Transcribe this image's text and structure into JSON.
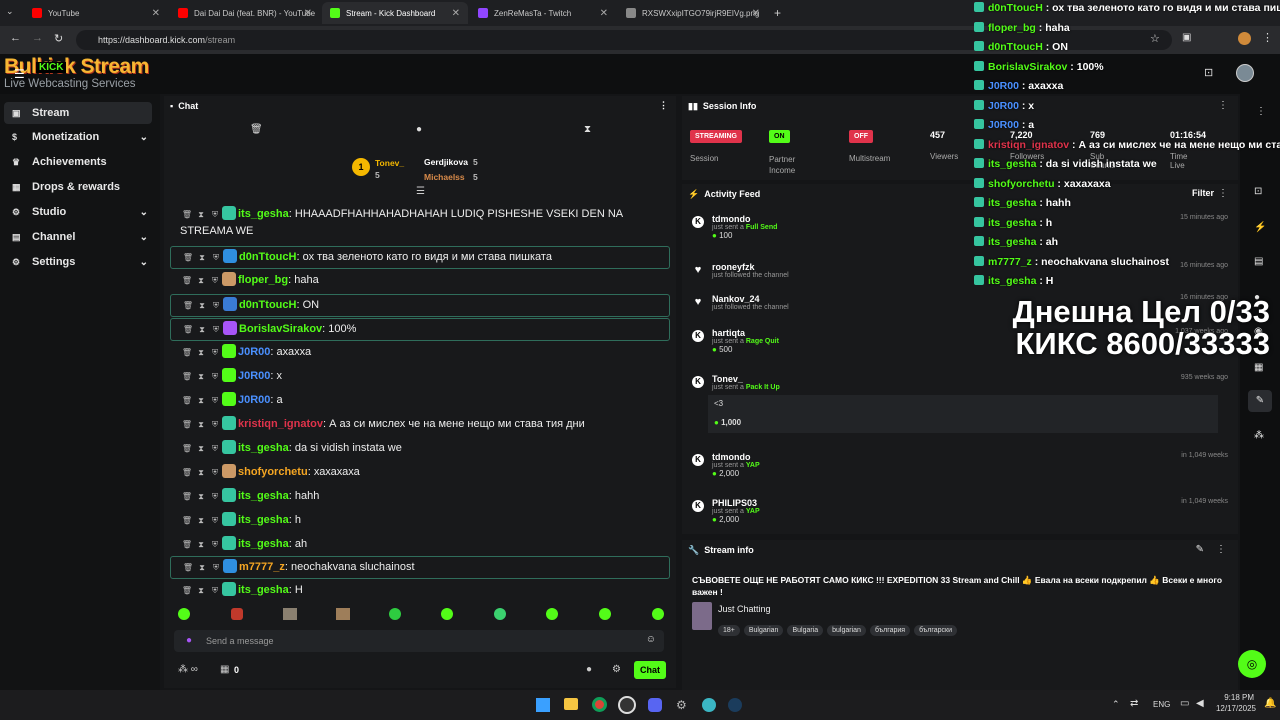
{
  "browser": {
    "tabs": [
      {
        "label": "YouTube",
        "color": "#ff0000"
      },
      {
        "label": "Dai Dai Dai (feat. BNR) - YouTube",
        "color": "#ff0000"
      },
      {
        "label": "Stream - Kick Dashboard",
        "color": "#53fc18"
      },
      {
        "label": "ZenReMasTa - Twitch",
        "color": "#9146ff"
      },
      {
        "label": "RXSWXxipITGO79irjR9EIVg.png",
        "color": "#888888"
      }
    ],
    "url_host": "https://dashboard.kick.com",
    "url_path": "/stream"
  },
  "brand": {
    "logo_text": "Bulkick Stream",
    "logo_sub": "Live Webcasting Services",
    "kick_tag": "KICK"
  },
  "sidebar": {
    "items": [
      {
        "label": "Stream",
        "icon": "monitor-icon",
        "active": true
      },
      {
        "label": "Monetization",
        "icon": "dollar-icon",
        "chevron": true
      },
      {
        "label": "Achievements",
        "icon": "trophy-icon"
      },
      {
        "label": "Drops & rewards",
        "icon": "gift-icon"
      },
      {
        "label": "Studio",
        "icon": "studio-icon",
        "chevron": true
      },
      {
        "label": "Channel",
        "icon": "channel-icon",
        "chevron": true
      },
      {
        "label": "Settings",
        "icon": "gear-icon",
        "chevron": true
      }
    ]
  },
  "chat": {
    "title": "Chat",
    "leaderboard": {
      "first": {
        "name": "Tonev_",
        "count": "5"
      },
      "second": {
        "name": "Gerdjikova",
        "count": "5"
      },
      "third": {
        "name": "Michaelss",
        "count": "5"
      }
    },
    "messages": [
      {
        "user": "its_gesha",
        "text": "HHAAADFHAHHAHADHAHAH LUDIQ PISHESHE VSEKI DEN NA STREAMA WE",
        "color": "#53fc18",
        "hl": false
      },
      {
        "user": "d0nTtoucH",
        "text": "ох тва зеленото като го видя и ми става пишката",
        "color": "#53fc18",
        "hl": true
      },
      {
        "user": "floper_bg",
        "text": "haha",
        "color": "#53fc18",
        "hl": false
      },
      {
        "user": "d0nTtoucH",
        "text": "ON",
        "color": "#53fc18",
        "hl": true
      },
      {
        "user": "BorislavSirakov",
        "text": "100%",
        "color": "#53fc18",
        "hl": true
      },
      {
        "user": "J0R00",
        "text": "ахахха",
        "color": "#4a90ff",
        "hl": false
      },
      {
        "user": "J0R00",
        "text": "x",
        "color": "#4a90ff",
        "hl": false
      },
      {
        "user": "J0R00",
        "text": "a",
        "color": "#4a90ff",
        "hl": false
      },
      {
        "user": "kristiqn_ignatov",
        "text": "А аз си мислех че на мене нещо ми става тия дни",
        "color": "#e0334b",
        "hl": false
      },
      {
        "user": "its_gesha",
        "text": "da si vidish instata we",
        "color": "#53fc18",
        "hl": false
      },
      {
        "user": "shofyorchetu",
        "text": "хахахаха",
        "color": "#f5a623",
        "hl": false
      },
      {
        "user": "its_gesha",
        "text": "hahh",
        "color": "#53fc18",
        "hl": false
      },
      {
        "user": "its_gesha",
        "text": "h",
        "color": "#53fc18",
        "hl": false
      },
      {
        "user": "its_gesha",
        "text": "ah",
        "color": "#53fc18",
        "hl": false
      },
      {
        "user": "m7777_z",
        "text": "neochakvana sluchainost",
        "color": "#f5a623",
        "hl": true
      },
      {
        "user": "its_gesha",
        "text": "H",
        "color": "#53fc18",
        "hl": false
      }
    ],
    "input_placeholder": "Send a message",
    "points_count": "0",
    "chat_button": "Chat"
  },
  "session": {
    "title": "Session Info",
    "stats": [
      {
        "badge": "STREAMING",
        "label": "Session",
        "badge_color": "#e0334b"
      },
      {
        "badge": "ON",
        "label": "Partner Income",
        "badge_color": "#53fc18"
      },
      {
        "badge": "OFF",
        "label": "Multistream",
        "badge_color": "#e0334b"
      }
    ],
    "numbers": [
      {
        "value": "457",
        "label": "Viewers"
      },
      {
        "value": "7,220",
        "label": "Followers"
      },
      {
        "value": "769",
        "label": "Sub Counts"
      },
      {
        "value": "01:16:54",
        "label": "Time Live"
      }
    ]
  },
  "activity": {
    "title": "Activity Feed",
    "filter": "Filter",
    "items": [
      {
        "name": "tdmondo",
        "action": "just sent a",
        "item": "Full Send",
        "amount": "100",
        "when": "15 minutes ago",
        "icon": "kick-icon"
      },
      {
        "name": "rooneyfzk",
        "action": "just followed the channel",
        "item": "",
        "amount": "",
        "when": "16 minutes ago",
        "icon": "heart-icon"
      },
      {
        "name": "Nankov_24",
        "action": "just followed the channel",
        "item": "",
        "amount": "",
        "when": "16 minutes ago",
        "icon": "heart-icon"
      },
      {
        "name": "hartiqta",
        "action": "just sent a",
        "item": "Rage Quit",
        "amount": "500",
        "when": "1,037 weeks ago",
        "icon": "kick-icon"
      },
      {
        "name": "Tonev_",
        "action": "just sent a",
        "item": "Pack It Up",
        "amount": "1,000",
        "when": "935 weeks ago",
        "icon": "kick-icon",
        "note": "<3"
      },
      {
        "name": "tdmondo",
        "action": "just sent a",
        "item": "YAP",
        "amount": "2,000",
        "when": "in 1,049 weeks",
        "icon": "kick-icon"
      },
      {
        "name": "PHILIPS03",
        "action": "just sent a",
        "item": "YAP",
        "amount": "2,000",
        "when": "in 1,049 weeks",
        "icon": "kick-icon"
      }
    ]
  },
  "stream_info": {
    "title": "Stream info",
    "stream_title": "СЪВОВЕТЕ ОЩЕ НЕ РАБОТЯТ САМО КИКС !!! EXPEDITION 33 Stream and Chill 👍 Евала на всеки подкрепил 👍 Всеки е много важен !",
    "category": "Just Chatting",
    "tags": [
      "18+",
      "Bulgarian",
      "Bulgaria",
      "bulgarian",
      "българия",
      "български"
    ]
  },
  "overlay": {
    "messages": [
      {
        "user": "d0nTtoucH",
        "text": "ох тва зеленото като го видя и ми става пишката",
        "cls": "u"
      },
      {
        "user": "floper_bg",
        "text": "haha",
        "cls": "u"
      },
      {
        "user": "d0nTtoucH",
        "text": "ON",
        "cls": "u"
      },
      {
        "user": "BorislavSirakov",
        "text": "100%",
        "cls": "u"
      },
      {
        "user": "J0R00",
        "text": "ахахха",
        "cls": "ub"
      },
      {
        "user": "J0R00",
        "text": "x",
        "cls": "ub"
      },
      {
        "user": "J0R00",
        "text": "a",
        "cls": "ub"
      },
      {
        "user": "kristiqn_ignatov",
        "text": "А аз си мислех че на мене нещо ми става",
        "cls": "ur"
      },
      {
        "user": "its_gesha",
        "text": "da si vidish instata we",
        "cls": "u"
      },
      {
        "user": "shofyorchetu",
        "text": "хахахаха",
        "cls": "u"
      },
      {
        "user": "its_gesha",
        "text": "hahh",
        "cls": "u"
      },
      {
        "user": "its_gesha",
        "text": "h",
        "cls": "u"
      },
      {
        "user": "its_gesha",
        "text": "ah",
        "cls": "u"
      },
      {
        "user": "m7777_z",
        "text": "neochakvana sluchainost",
        "cls": "u"
      },
      {
        "user": "its_gesha",
        "text": "H",
        "cls": "u"
      }
    ],
    "goal_line1": "Днешна Цел 0/33",
    "goal_line2": "КИКС 8600/33333"
  },
  "taskbar": {
    "lang": "ENG",
    "time": "9:18 PM",
    "date": "12/17/2025"
  },
  "colors": {
    "accent": "#53fc18",
    "bg": "#18191b"
  }
}
